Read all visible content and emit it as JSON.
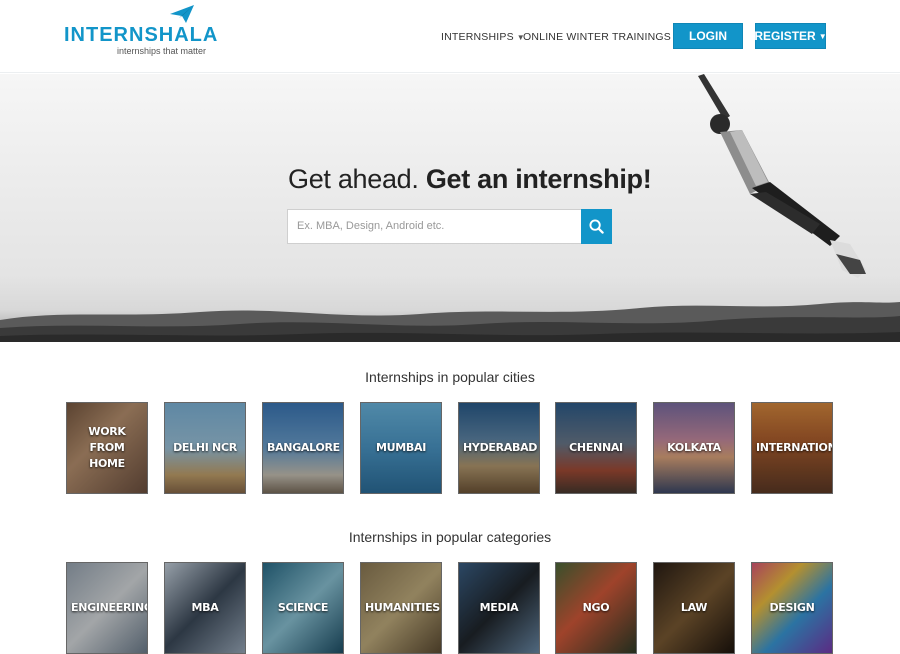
{
  "header": {
    "logo_intern": "INTERN",
    "logo_shala": "SHALA",
    "logo_tagline": "internships that matter",
    "nav_internships": "INTERNSHIPS",
    "nav_trainings": "ONLINE WINTER TRAININGS",
    "login": "LOGIN",
    "register": "REGISTER"
  },
  "hero": {
    "title_light": "Get ahead.",
    "title_bold": "Get an internship!",
    "search_placeholder": "Ex. MBA, Design, Android etc."
  },
  "cities": {
    "title": "Internships in popular cities",
    "items": [
      "WORK FROM HOME",
      "DELHI NCR",
      "BANGALORE",
      "MUMBAI",
      "HYDERABAD",
      "CHENNAI",
      "KOLKATA",
      "INTERNATIONAL"
    ]
  },
  "categories": {
    "title": "Internships in popular categories",
    "items": [
      "ENGINEERING",
      "MBA",
      "SCIENCE",
      "HUMANITIES",
      "MEDIA",
      "NGO",
      "LAW",
      "DESIGN"
    ]
  },
  "colors": {
    "brand": "#1295c9"
  }
}
